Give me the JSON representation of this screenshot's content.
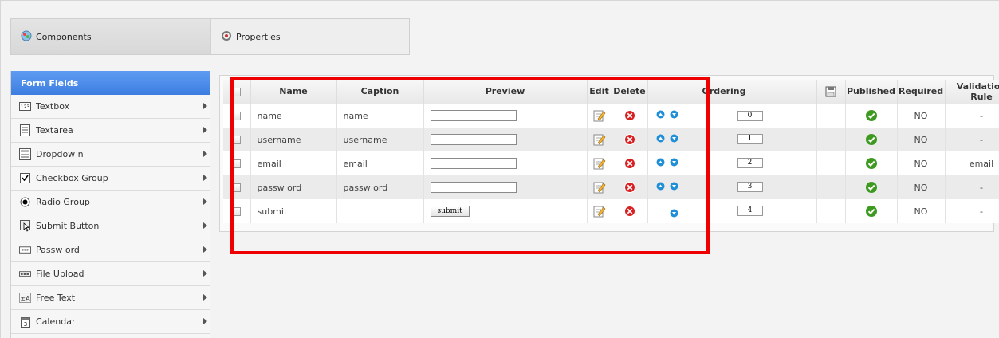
{
  "tabs": [
    {
      "label": "Components",
      "icon": "components-icon"
    },
    {
      "label": "Properties",
      "icon": "properties-icon"
    }
  ],
  "sidebar": {
    "header": "Form Fields",
    "items": [
      {
        "label": "Textbox",
        "icon": "textbox-icon"
      },
      {
        "label": "Textarea",
        "icon": "textarea-icon"
      },
      {
        "label": "Dropdow n",
        "icon": "dropdown-icon"
      },
      {
        "label": "Checkbox Group",
        "icon": "checkbox-icon"
      },
      {
        "label": "Radio Group",
        "icon": "radio-icon"
      },
      {
        "label": "Submit Button",
        "icon": "submit-button-icon"
      },
      {
        "label": "Passw ord",
        "icon": "password-icon"
      },
      {
        "label": "File Upload",
        "icon": "file-upload-icon"
      },
      {
        "label": "Free Text",
        "icon": "free-text-icon"
      },
      {
        "label": "Calendar",
        "icon": "calendar-icon"
      }
    ]
  },
  "grid": {
    "columns": {
      "name": "Name",
      "caption": "Caption",
      "preview": "Preview",
      "edit": "Edit",
      "delete": "Delete",
      "ordering": "Ordering",
      "published": "Published",
      "required": "Required",
      "validation": "Validation Rule"
    },
    "rows": [
      {
        "name": "name",
        "caption": "name",
        "preview_type": "input",
        "preview_label": "",
        "order": "0",
        "required": "NO",
        "validation": "-"
      },
      {
        "name": "username",
        "caption": "username",
        "preview_type": "input",
        "preview_label": "",
        "order": "1",
        "required": "NO",
        "validation": "-"
      },
      {
        "name": "email",
        "caption": "email",
        "preview_type": "input",
        "preview_label": "",
        "order": "2",
        "required": "NO",
        "validation": "email"
      },
      {
        "name": "passw ord",
        "caption": "passw ord",
        "preview_type": "input",
        "preview_label": "",
        "order": "3",
        "required": "NO",
        "validation": "-"
      },
      {
        "name": "submit",
        "caption": "",
        "preview_type": "button",
        "preview_label": "submit",
        "order": "4",
        "required": "NO",
        "validation": "-"
      }
    ]
  },
  "colors": {
    "accent_blue": "#3d7ee0",
    "highlight_red": "#ee0000",
    "published_green": "#3d9a1f",
    "delete_red": "#d92020"
  }
}
